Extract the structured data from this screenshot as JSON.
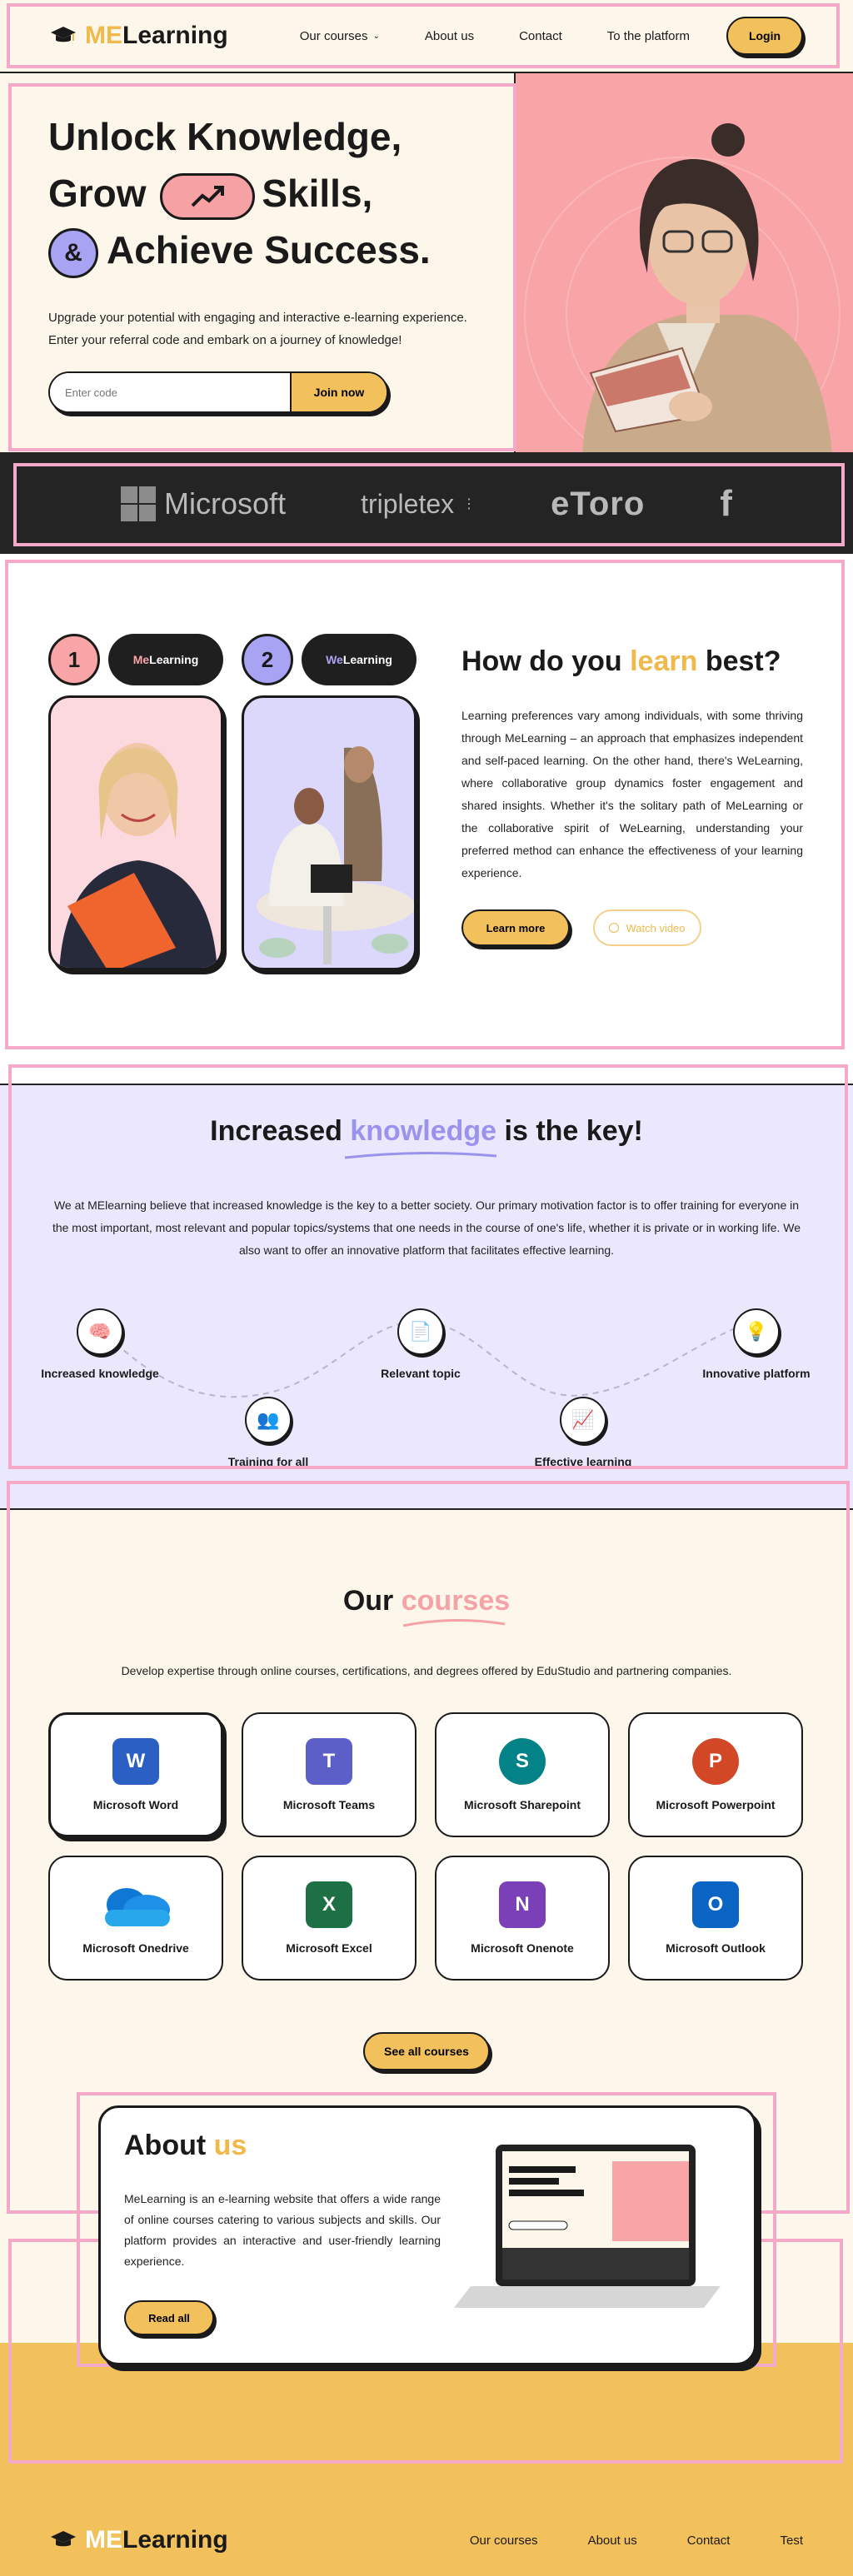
{
  "nav": {
    "logo_me": "ME",
    "logo_rest": "Learning",
    "links": [
      "Our courses",
      "About us",
      "Contact",
      "To the platform"
    ],
    "login": "Login"
  },
  "hero": {
    "line1": "Unlock Knowledge,",
    "line2a": "Grow",
    "line2b": "Skills,",
    "line3_symbol": "&",
    "line3": "Achieve Success.",
    "subtitle_1": "Upgrade your potential with engaging and interactive e-learning experience.",
    "subtitle_2": "Enter your referral code and embark on a journey of knowledge!",
    "input_placeholder": "Enter code",
    "cta": "Join now"
  },
  "partners": [
    "Microsoft",
    "tripletex",
    "eToro",
    "f"
  ],
  "learn": {
    "card1": {
      "num": "1",
      "tag_a": "Me",
      "tag_b": "Learning"
    },
    "card2": {
      "num": "2",
      "tag_a": "We",
      "tag_b": "Learning"
    },
    "title_a": "How do you",
    "title_hl": "learn",
    "title_b": "best?",
    "body": "Learning preferences vary among individuals, with some thriving through MeLearning – an approach that emphasizes independent and self-paced learning. On the other hand, there's WeLearning, where collaborative group dynamics foster engagement and shared insights. Whether it's the solitary path of MeLearning or the collaborative spirit of WeLearning, understanding your preferred method can enhance the effectiveness of your learning experience.",
    "btn_more": "Learn more",
    "btn_video": "Watch video"
  },
  "knowledge": {
    "title_a": "Increased",
    "title_hl": "knowledge",
    "title_b": "is the key!",
    "body": "We at MElearning believe that increased knowledge is the key to a better society. Our primary motivation factor is to offer training for everyone in the most important, most relevant and popular topics/systems that one needs in the course of one's life, whether it is private or in working life. We also want to offer an innovative platform that facilitates effective learning.",
    "steps": [
      {
        "label": "Increased knowledge",
        "icon": "brain-icon"
      },
      {
        "label": "Training for all",
        "icon": "people-icon"
      },
      {
        "label": "Relevant topic",
        "icon": "document-icon"
      },
      {
        "label": "Effective learning",
        "icon": "chart-icon"
      },
      {
        "label": "Innovative platform",
        "icon": "lightbulb-icon"
      }
    ]
  },
  "courses": {
    "title_a": "Our",
    "title_hl": "courses",
    "subtitle": "Develop expertise through online courses, certifications, and degrees offered by EduStudio and partnering companies.",
    "items": [
      {
        "name": "Microsoft Word",
        "letter": "W",
        "color": "#2b5fc4"
      },
      {
        "name": "Microsoft Teams",
        "letter": "T",
        "color": "#5b5fc7"
      },
      {
        "name": "Microsoft Sharepoint",
        "letter": "S",
        "color": "#038387"
      },
      {
        "name": "Microsoft Powerpoint",
        "letter": "P",
        "color": "#d24726"
      },
      {
        "name": "Microsoft Onedrive",
        "letter": "",
        "color": "#0f78d4"
      },
      {
        "name": "Microsoft Excel",
        "letter": "X",
        "color": "#1d7044"
      },
      {
        "name": "Microsoft Onenote",
        "letter": "N",
        "color": "#7b3fb8"
      },
      {
        "name": "Microsoft Outlook",
        "letter": "O",
        "color": "#0a64c4"
      }
    ],
    "see_all": "See all courses"
  },
  "about": {
    "title_a": "About",
    "title_hl": "us",
    "body": "MeLearning is an e-learning website that offers a wide range of online courses catering to various subjects and skills. Our platform provides an interactive and user-friendly learning experience.",
    "btn": "Read all"
  },
  "footer": {
    "logo_me": "ME",
    "logo_rest": "Learning",
    "links": [
      "Our courses",
      "About us",
      "Contact",
      "Test"
    ]
  },
  "colors": {
    "cream": "#fdf6ea",
    "yellow": "#f3c15c",
    "pink": "#f9a5a8",
    "lavender": "#ebe8fd",
    "dark": "#1a1a1a"
  }
}
